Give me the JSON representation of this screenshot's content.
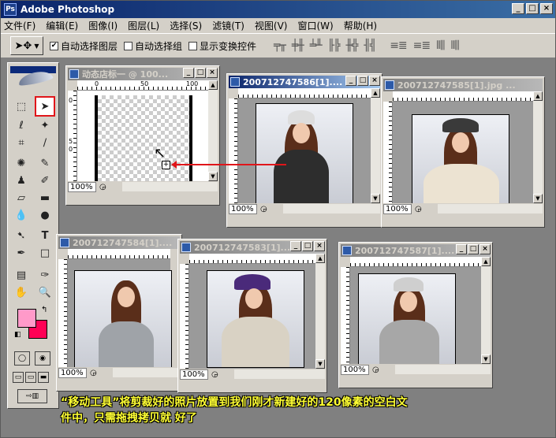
{
  "app": {
    "title": "Adobe Photoshop",
    "window_buttons": [
      "_",
      "□",
      "×"
    ]
  },
  "menu": [
    "文件(F)",
    "编辑(E)",
    "图像(I)",
    "图层(L)",
    "选择(S)",
    "滤镜(T)",
    "视图(V)",
    "窗口(W)",
    "帮助(H)"
  ],
  "options": {
    "auto_select_layer": {
      "label": "自动选择图层",
      "checked": true
    },
    "auto_select_group": {
      "label": "自动选择组",
      "checked": false
    },
    "show_transform": {
      "label": "显示变换控件",
      "checked": false
    }
  },
  "documents": [
    {
      "id": "doc1",
      "title": "动态店标一 @ 100...",
      "zoom": "100%",
      "active": false,
      "ruler_h": [
        "0",
        "50",
        "100"
      ],
      "ruler_v": [
        "0",
        "5",
        "0",
        "5",
        "0"
      ]
    },
    {
      "id": "doc2",
      "title": "200712747586[1]....",
      "zoom": "100%",
      "active": true
    },
    {
      "id": "doc3",
      "title": "200712747585[1].jpg ...",
      "zoom": "100%",
      "active": false
    },
    {
      "id": "doc4",
      "title": "200712747584[1]....",
      "zoom": "100%",
      "active": false
    },
    {
      "id": "doc5",
      "title": "200712747583[1]....",
      "zoom": "100%",
      "active": false
    },
    {
      "id": "doc6",
      "title": "200712747587[1]....",
      "zoom": "100%",
      "active": false
    }
  ],
  "colors": {
    "foreground": "#ff9ac9",
    "background": "#ff0055",
    "highlight": "#e0151a"
  },
  "caption": {
    "line1": "“移动工具”将剪裁好的照片放置到我们刚才新建好的120像素的空白文",
    "line2": "件中，只需拖拽拷贝就 好了"
  }
}
